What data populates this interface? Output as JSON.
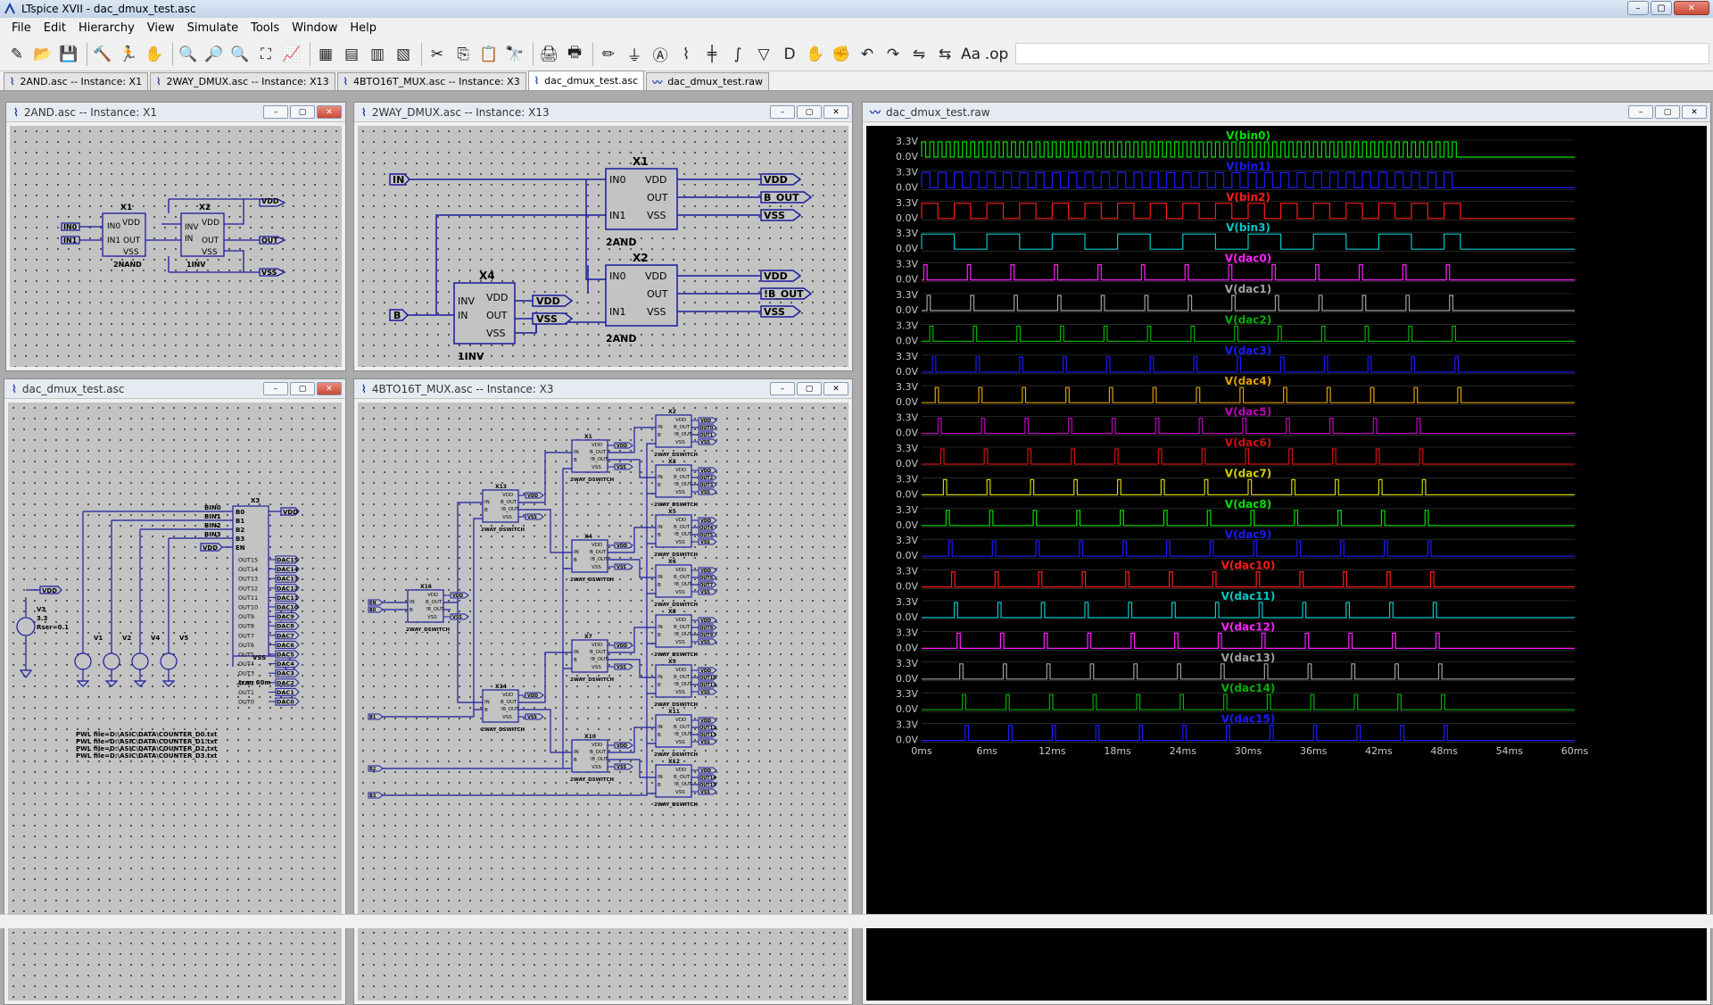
{
  "app": {
    "title": "LTspice XVII - dac_dmux_test.asc",
    "window_buttons": {
      "minimize": "–",
      "maximize": "▢",
      "close": "✕"
    }
  },
  "menu": [
    "File",
    "Edit",
    "Hierarchy",
    "View",
    "Simulate",
    "Tools",
    "Window",
    "Help"
  ],
  "toolbar": {
    "icons": [
      "new-schematic-icon",
      "open-folder-icon",
      "save-icon",
      "control-panel-icon",
      "run-icon",
      "halt-hand-icon",
      "zoom-in-icon",
      "zoom-pan-icon",
      "zoom-out-icon",
      "zoom-fit-icon",
      "autorange-icon",
      "delete-window-icon",
      "tile-horizontal-icon",
      "tile-vertical-icon",
      "cascade-icon",
      "cut-icon",
      "copy-icon",
      "paste-icon",
      "find-icon",
      "print-setup-icon",
      "print-icon",
      "wire-icon",
      "ground-icon",
      "label-net-icon",
      "resistor-icon",
      "capacitor-icon",
      "inductor-icon",
      "diode-icon",
      "component-icon",
      "move-icon",
      "drag-icon",
      "undo-icon",
      "redo-icon",
      "rotate-icon",
      "mirror-icon",
      "text-icon",
      "spice-directive-icon"
    ],
    "glyphs": [
      "✎",
      "📂",
      "💾",
      "🔨",
      "🏃",
      "✋",
      "🔍",
      "🔎",
      "🔍",
      "⛶",
      "📈",
      "▦",
      "▤",
      "▥",
      "▧",
      "✂",
      "⎘",
      "📋",
      "🔭",
      "🖨",
      "🖶",
      "✏",
      "⏚",
      "Ⓐ",
      "⌇",
      "╪",
      "∫",
      "▽",
      "D",
      "✋",
      "✊",
      "↶",
      "↷",
      "⇋",
      "⇆",
      "Aa",
      ".op"
    ]
  },
  "tabs": [
    {
      "label": "2AND.asc -- Instance: X1",
      "icon": "schematic-icon",
      "active": false
    },
    {
      "label": "2WAY_DMUX.asc -- Instance: X13",
      "icon": "schematic-icon",
      "active": false
    },
    {
      "label": "4BTO16T_MUX.asc -- Instance: X3",
      "icon": "schematic-icon",
      "active": false
    },
    {
      "label": "dac_dmux_test.asc",
      "icon": "schematic-icon",
      "active": true
    },
    {
      "label": "dac_dmux_test.raw",
      "icon": "waveform-icon",
      "active": false
    }
  ],
  "windows": {
    "and2": {
      "title": "2AND.asc -- Instance: X1",
      "labels": {
        "x1": "X1",
        "x2": "X2",
        "in0": "IN0",
        "in1": "IN1",
        "vdd": "VDD",
        "out": "OUT",
        "vss": "VSS",
        "inv": "INV",
        "in": "IN",
        "u1": "2NAND",
        "u2": "1INV"
      }
    },
    "dmux2": {
      "title": "2WAY_DMUX.asc -- Instance: X13",
      "labels": {
        "x1": "X1",
        "x2": "X2",
        "x4": "X4",
        "in": "IN",
        "b": "B",
        "in0": "IN0",
        "in1": "IN1",
        "vdd": "VDD",
        "out": "OUT",
        "vss": "VSS",
        "inv": "INV",
        "bout": "B_OUT",
        "nbout": "!B_OUT",
        "and": "2AND",
        "inv1": "1INV"
      }
    },
    "top": {
      "title": "dac_dmux_test.asc",
      "labels": {
        "x3": "X3",
        "bin0": "BIN0",
        "bin1": "BIN1",
        "bin2": "BIN2",
        "bin3": "BIN3",
        "vdd": "VDD",
        "vss": "VSS",
        "en": "EN",
        "b0": "B0",
        "b1": "B1",
        "b2": "B2",
        "b3": "B3",
        "v1": "V1",
        "v2": "V2",
        "v4": "V4",
        "v5": "V5",
        "v3": "V3",
        "v3val": "3.3",
        "rser": "Rser=0.1",
        "tran": ".tran 60m",
        "pwl": [
          "PWL file=D:\\ASIC\\DATA\\COUNTER_D0.txt",
          "PWL file=D:\\ASIC\\DATA\\COUNTER_D1.txt",
          "PWL file=D:\\ASIC\\DATA\\COUNTER_D2.txt",
          "PWL file=D:\\ASIC\\DATA\\COUNTER_D3.txt"
        ],
        "outs": [
          "OUT15",
          "OUT14",
          "OUT13",
          "OUT12",
          "OUT11",
          "OUT10",
          "OUT9",
          "OUT8",
          "OUT7",
          "OUT6",
          "OUT5",
          "OUT4",
          "OUT3",
          "OUT2",
          "OUT1",
          "OUT0"
        ],
        "dacs": [
          "DAC15",
          "DAC14",
          "DAC13",
          "DAC12",
          "DAC11",
          "DAC10",
          "DAC9",
          "DAC8",
          "DAC7",
          "DAC6",
          "DAC5",
          "DAC4",
          "DAC3",
          "DAC2",
          "DAC1",
          "DAC0"
        ]
      }
    },
    "mux16": {
      "title": "4BTO16T_MUX.asc -- Instance: X3",
      "labels": {
        "sw": "2WAY_DSWITCH",
        "in": "IN",
        "b": "B",
        "vdd": "VDD",
        "vss": "VSS",
        "bout": "B_OUT",
        "nbout": "!B_OUT",
        "en": "EN",
        "b0": "B0",
        "b1": "B1",
        "b2": "B2",
        "b3": "B3",
        "stage1": [
          "X16"
        ],
        "stage2": [
          "X13",
          "X14"
        ],
        "stage3": [
          "X1",
          "X4",
          "X7",
          "X10"
        ],
        "stage4": [
          "X2",
          "X3",
          "X5",
          "X6",
          "X8",
          "X9",
          "X11",
          "X12"
        ],
        "outs": [
          "OUT0",
          "OUT1",
          "OUT2",
          "OUT3",
          "OUT4",
          "OUT5",
          "OUT6",
          "OUT7",
          "OUT8",
          "OUT9",
          "OUT10",
          "OUT11",
          "OUT12",
          "OUT13",
          "OUT14",
          "OUT15"
        ]
      }
    },
    "wave": {
      "title": "dac_dmux_test.raw"
    }
  },
  "chart_data": {
    "type": "line",
    "title": "",
    "xlabel": "",
    "ylabel": "",
    "x_unit": "ms",
    "xlim": [
      0,
      60
    ],
    "ylim": [
      0,
      3.3
    ],
    "x_ticks": [
      "0ms",
      "6ms",
      "12ms",
      "18ms",
      "24ms",
      "30ms",
      "36ms",
      "42ms",
      "48ms",
      "54ms",
      "60ms"
    ],
    "y_ticks": [
      "3.3V",
      "0.0V"
    ],
    "grid": false,
    "series": [
      {
        "name": "V(bin0)",
        "color": "#00e000",
        "kind": "clock",
        "period_ms": 0.75,
        "stop_ms": 49.5
      },
      {
        "name": "V(bin1)",
        "color": "#1a1aff",
        "kind": "clock",
        "period_ms": 1.5,
        "stop_ms": 49.5
      },
      {
        "name": "V(bin2)",
        "color": "#ff1a1a",
        "kind": "clock",
        "period_ms": 3.0,
        "stop_ms": 49.5
      },
      {
        "name": "V(bin3)",
        "color": "#00c8c8",
        "kind": "clock",
        "period_ms": 6.0,
        "stop_ms": 49.5
      },
      {
        "name": "V(dac0)",
        "color": "#ff20ff",
        "kind": "pulse",
        "first_ms": 0.2,
        "period_ms": 4.0,
        "width_ms": 0.3,
        "stop_ms": 49.5
      },
      {
        "name": "V(dac1)",
        "color": "#a0a0a0",
        "kind": "pulse",
        "first_ms": 0.5,
        "period_ms": 4.0,
        "width_ms": 0.3,
        "stop_ms": 49.5
      },
      {
        "name": "V(dac2)",
        "color": "#00b000",
        "kind": "pulse",
        "first_ms": 0.75,
        "period_ms": 4.0,
        "width_ms": 0.3,
        "stop_ms": 49.5
      },
      {
        "name": "V(dac3)",
        "color": "#1a1aff",
        "kind": "pulse",
        "first_ms": 1.0,
        "period_ms": 4.0,
        "width_ms": 0.3,
        "stop_ms": 49.5
      },
      {
        "name": "V(dac4)",
        "color": "#e0a000",
        "kind": "pulse",
        "first_ms": 1.25,
        "period_ms": 4.0,
        "width_ms": 0.3,
        "stop_ms": 49.5
      },
      {
        "name": "V(dac5)",
        "color": "#c000c0",
        "kind": "pulse",
        "first_ms": 1.5,
        "period_ms": 4.0,
        "width_ms": 0.3,
        "stop_ms": 49.5
      },
      {
        "name": "V(dac6)",
        "color": "#d01010",
        "kind": "pulse",
        "first_ms": 1.75,
        "period_ms": 4.0,
        "width_ms": 0.3,
        "stop_ms": 49.5
      },
      {
        "name": "V(dac7)",
        "color": "#d0d000",
        "kind": "pulse",
        "first_ms": 2.0,
        "period_ms": 4.0,
        "width_ms": 0.3,
        "stop_ms": 49.5
      },
      {
        "name": "V(dac8)",
        "color": "#00e000",
        "kind": "pulse",
        "first_ms": 2.25,
        "period_ms": 4.0,
        "width_ms": 0.3,
        "stop_ms": 49.5
      },
      {
        "name": "V(dac9)",
        "color": "#1a1aff",
        "kind": "pulse",
        "first_ms": 2.5,
        "period_ms": 4.0,
        "width_ms": 0.3,
        "stop_ms": 49.5
      },
      {
        "name": "V(dac10)",
        "color": "#ff1a1a",
        "kind": "pulse",
        "first_ms": 2.75,
        "period_ms": 4.0,
        "width_ms": 0.3,
        "stop_ms": 49.5
      },
      {
        "name": "V(dac11)",
        "color": "#00c8c8",
        "kind": "pulse",
        "first_ms": 3.0,
        "period_ms": 4.0,
        "width_ms": 0.3,
        "stop_ms": 49.5
      },
      {
        "name": "V(dac12)",
        "color": "#ff20ff",
        "kind": "pulse",
        "first_ms": 3.25,
        "period_ms": 4.0,
        "width_ms": 0.3,
        "stop_ms": 49.5
      },
      {
        "name": "V(dac13)",
        "color": "#a0a0a0",
        "kind": "pulse",
        "first_ms": 3.5,
        "period_ms": 4.0,
        "width_ms": 0.3,
        "stop_ms": 49.5
      },
      {
        "name": "V(dac14)",
        "color": "#00b000",
        "kind": "pulse",
        "first_ms": 3.75,
        "period_ms": 4.0,
        "width_ms": 0.3,
        "stop_ms": 49.5
      },
      {
        "name": "V(dac15)",
        "color": "#1a1aff",
        "kind": "pulse",
        "first_ms": 4.0,
        "period_ms": 4.0,
        "width_ms": 0.3,
        "stop_ms": 49.5
      }
    ]
  }
}
